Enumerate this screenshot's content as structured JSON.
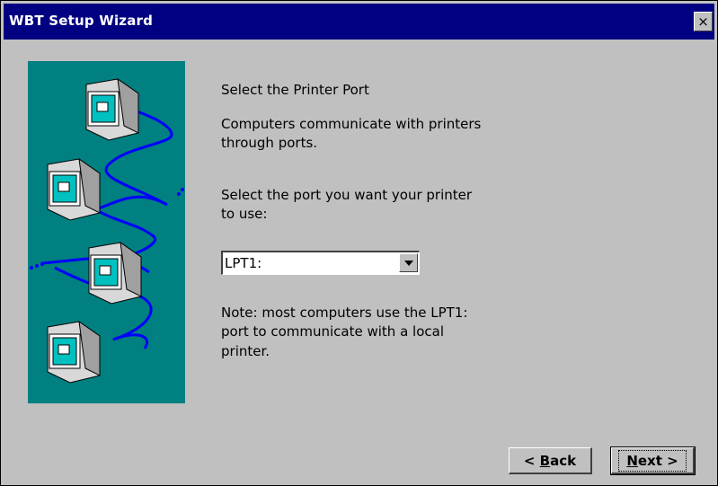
{
  "window": {
    "title": "WBT Setup Wizard",
    "close_glyph": "×"
  },
  "content": {
    "heading": "Select the Printer Port",
    "desc_line1": "Computers communicate with printers",
    "desc_line2": "through ports.",
    "prompt_line1": "Select the port you want your printer",
    "prompt_line2": "to use:",
    "note_line1": "Note: most computers use the LPT1:",
    "note_line2": "port to communicate with a local",
    "note_line3": "printer."
  },
  "port_select": {
    "selected": "LPT1:"
  },
  "buttons": {
    "back_prefix": "< ",
    "back_mnemonic": "B",
    "back_rest": "ack",
    "next_mnemonic": "N",
    "next_rest": "ext >"
  },
  "colors": {
    "titlebar": "#000080",
    "illustration_bg": "#008080",
    "network_line": "#0000ff",
    "window_bg": "#c0c0c0"
  },
  "icons": [
    "computer-icon",
    "computer-icon",
    "computer-icon",
    "computer-icon",
    "close-icon",
    "dropdown-arrow-icon"
  ]
}
